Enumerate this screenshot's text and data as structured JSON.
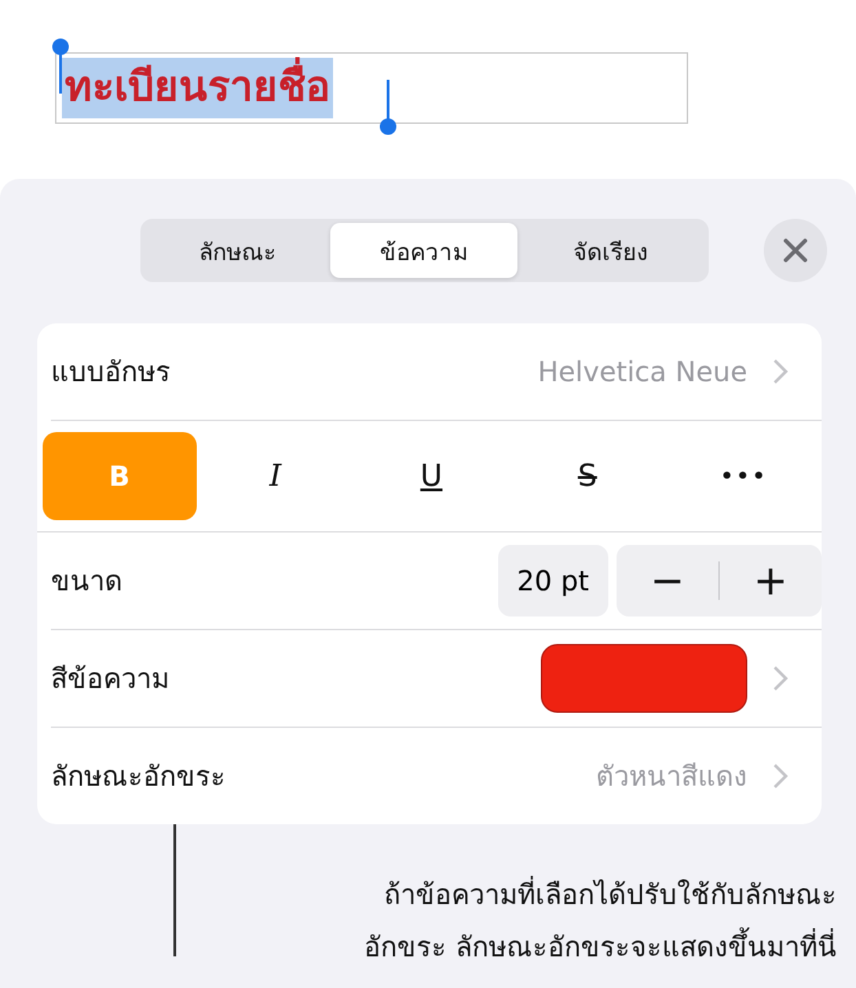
{
  "text_field": {
    "value": "ทะเบียนรายชื่อ",
    "selected": true
  },
  "tabs": [
    {
      "label": "ลักษณะ",
      "selected": false
    },
    {
      "label": "ข้อความ",
      "selected": true
    },
    {
      "label": "จัดเรียง",
      "selected": false
    }
  ],
  "font": {
    "label": "แบบอักษร",
    "value": "Helvetica Neue"
  },
  "style_buttons": [
    {
      "label": "B",
      "kind": "bold",
      "on": true
    },
    {
      "label": "I",
      "kind": "italic",
      "on": false
    },
    {
      "label": "U",
      "kind": "underline",
      "on": false
    },
    {
      "label": "S",
      "kind": "strike",
      "on": false
    },
    {
      "label": "•••",
      "kind": "more",
      "on": false
    }
  ],
  "size": {
    "label": "ขนาด",
    "value": "20 pt",
    "minus": "−",
    "plus": "+"
  },
  "text_color": {
    "label": "สีข้อความ",
    "color": "#ee2211"
  },
  "char_style": {
    "label": "ลักษณะอักขระ",
    "value": "ตัวหนาสีแดง"
  },
  "callout": [
    "ถ้าข้อความที่เลือกได้ปรับใช้กับลักษณะ",
    "อักขระ ลักษณะอักขระจะแสดงขึ้นมาที่นี่"
  ]
}
